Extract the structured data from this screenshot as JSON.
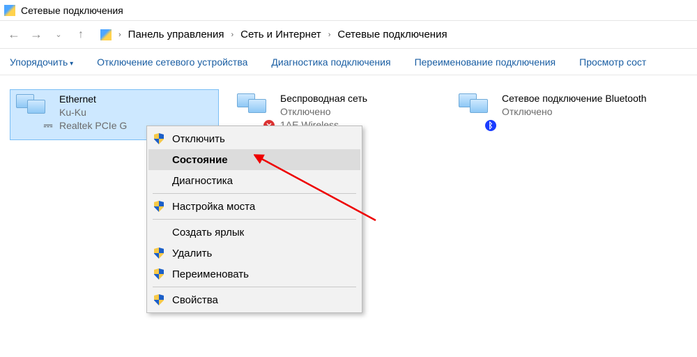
{
  "window": {
    "title": "Сетевые подключения"
  },
  "breadcrumbs": {
    "c0": "Панель управления",
    "c1": "Сеть и Интернет",
    "c2": "Сетевые подключения"
  },
  "toolbar": {
    "organize": "Упорядочить",
    "disable": "Отключение сетевого устройства",
    "diag": "Диагностика подключения",
    "rename": "Переименование подключения",
    "view": "Просмотр сост"
  },
  "tiles": {
    "eth": {
      "name": "Ethernet",
      "l2": "Ku-Ku",
      "l3": "Realtek PCIe G"
    },
    "wifi": {
      "name": "Беспроводная сеть",
      "l2": "Отключено",
      "l3": "1AE Wireless ..."
    },
    "bt": {
      "name": "Сетевое подключение Bluetooth",
      "l2": "Отключено"
    }
  },
  "menu": {
    "disable": "Отключить",
    "status": "Состояние",
    "diag": "Диагностика",
    "bridge": "Настройка моста",
    "shortcut": "Создать ярлык",
    "delete": "Удалить",
    "rename": "Переименовать",
    "props": "Свойства"
  }
}
